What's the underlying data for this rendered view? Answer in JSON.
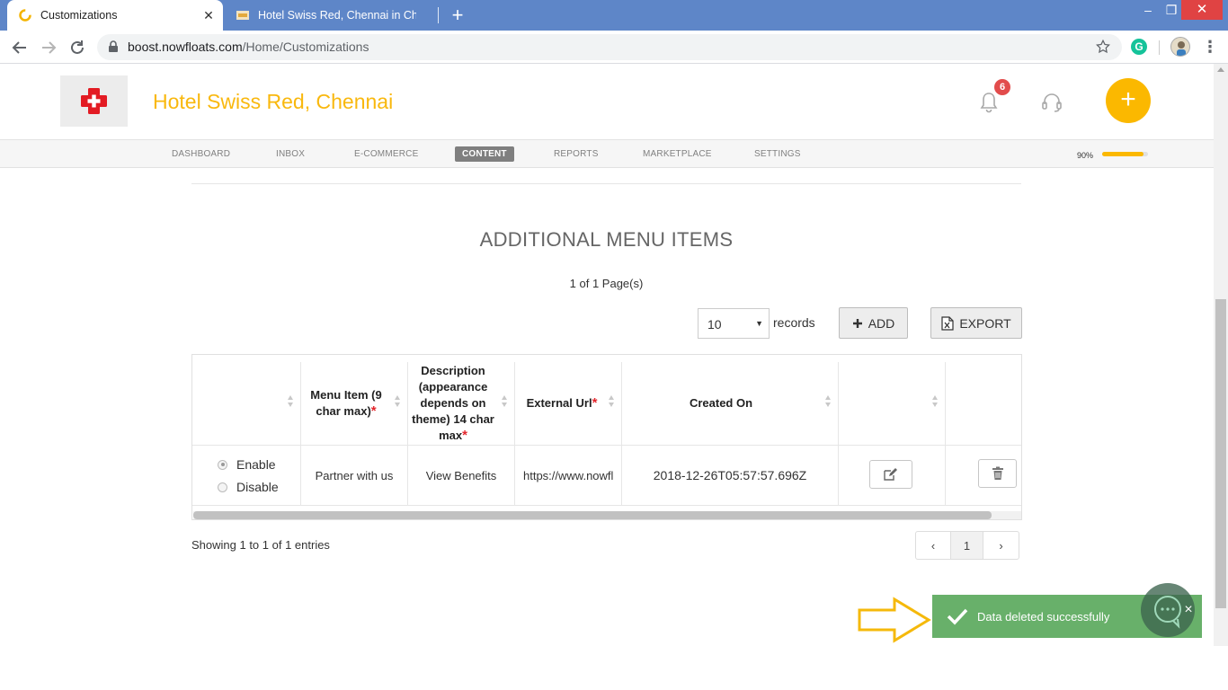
{
  "browser": {
    "tabs": [
      {
        "title": "Customizations",
        "active": true
      },
      {
        "title": "Hotel Swiss Red, Chennai in Chennai",
        "active": false
      }
    ],
    "url_host": "boost.nowfloats.com",
    "url_path": "/Home/Customizations",
    "extension_letter": "G"
  },
  "site": {
    "title": "Hotel Swiss Red, Chennai",
    "notification_count": "6",
    "brand_color": "#f9b80e",
    "nav": [
      {
        "label": "DASHBOARD"
      },
      {
        "label": "INBOX"
      },
      {
        "label": "E-COMMERCE"
      },
      {
        "label": "CONTENT",
        "active": true
      },
      {
        "label": "REPORTS"
      },
      {
        "label": "MARKETPLACE"
      },
      {
        "label": "SETTINGS"
      }
    ],
    "profile_progress_label": "90%",
    "profile_progress_value": 0.9
  },
  "section": {
    "heading": "ADDITIONAL MENU ITEMS",
    "page_info_prefix": "1 of ",
    "page_info_total": "1",
    "page_info_suffix": " Page(s)",
    "records_value": "10",
    "records_label": "records",
    "add_label": "ADD",
    "export_label": "EXPORT"
  },
  "table": {
    "headers": {
      "menu_item": "Menu Item (9 char max)",
      "description": "Description (appearance depends on theme) 14 char max",
      "external_url": "External Url",
      "created_on": "Created On"
    },
    "rows": [
      {
        "enable_label": "Enable",
        "disable_label": "Disable",
        "status": "Enable",
        "menu_item": "Partner with us",
        "description": "View Benefits",
        "external_url": "https://www.nowfloats.com",
        "created_on": "2018-12-26T05:57:57.696Z"
      }
    ]
  },
  "footer": {
    "showing": "Showing 1 to 1 of 1 entries",
    "prev": "‹",
    "current_page": "1",
    "next": "›"
  },
  "toast": {
    "message": "Data deleted successfully",
    "close": "×"
  }
}
